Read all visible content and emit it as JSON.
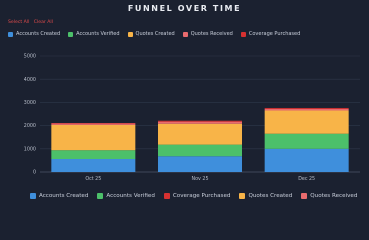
{
  "header": {
    "title": "FUNNEL OVER TIME"
  },
  "controls": {
    "select_all": "Select All",
    "clear_all": "Clear All"
  },
  "legend_top": [
    {
      "label": "Accounts Created",
      "color": "#3f8fdc"
    },
    {
      "label": "Accounts Verified",
      "color": "#4cc06a"
    },
    {
      "label": "Quotes Created",
      "color": "#f8b448"
    },
    {
      "label": "Quotes Received",
      "color": "#e96b6e"
    },
    {
      "label": "Coverage Purchased",
      "color": "#d63131"
    }
  ],
  "legend_bottom": [
    {
      "label": "Accounts Created",
      "color": "#3f8fdc"
    },
    {
      "label": "Accounts Verified",
      "color": "#4cc06a"
    },
    {
      "label": "Coverage Purchased",
      "color": "#d63131"
    },
    {
      "label": "Quotes Created",
      "color": "#f8b448"
    },
    {
      "label": "Quotes Received",
      "color": "#e96b6e"
    }
  ],
  "chart_data": {
    "type": "bar",
    "stacked": true,
    "title": "FUNNEL OVER TIME",
    "categories": [
      "Oct 25",
      "Nov 25",
      "Dec 25"
    ],
    "ylim": [
      0,
      5000
    ],
    "yticks": [
      "0",
      "1000",
      "2000",
      "3000",
      "4000",
      "5000"
    ],
    "grid": true,
    "series": [
      {
        "name": "Accounts Created",
        "color": "#3f8fdc",
        "values": [
          560,
          680,
          1000
        ]
      },
      {
        "name": "Accounts Verified",
        "color": "#4cc06a",
        "values": [
          380,
          500,
          650
        ]
      },
      {
        "name": "Quotes Created",
        "color": "#f8b448",
        "values": [
          1090,
          900,
          1000
        ]
      },
      {
        "name": "Quotes Received",
        "color": "#e96b6e",
        "values": [
          60,
          90,
          70
        ]
      },
      {
        "name": "Coverage Purchased",
        "color": "#d63131",
        "values": [
          20,
          40,
          40
        ]
      }
    ]
  }
}
